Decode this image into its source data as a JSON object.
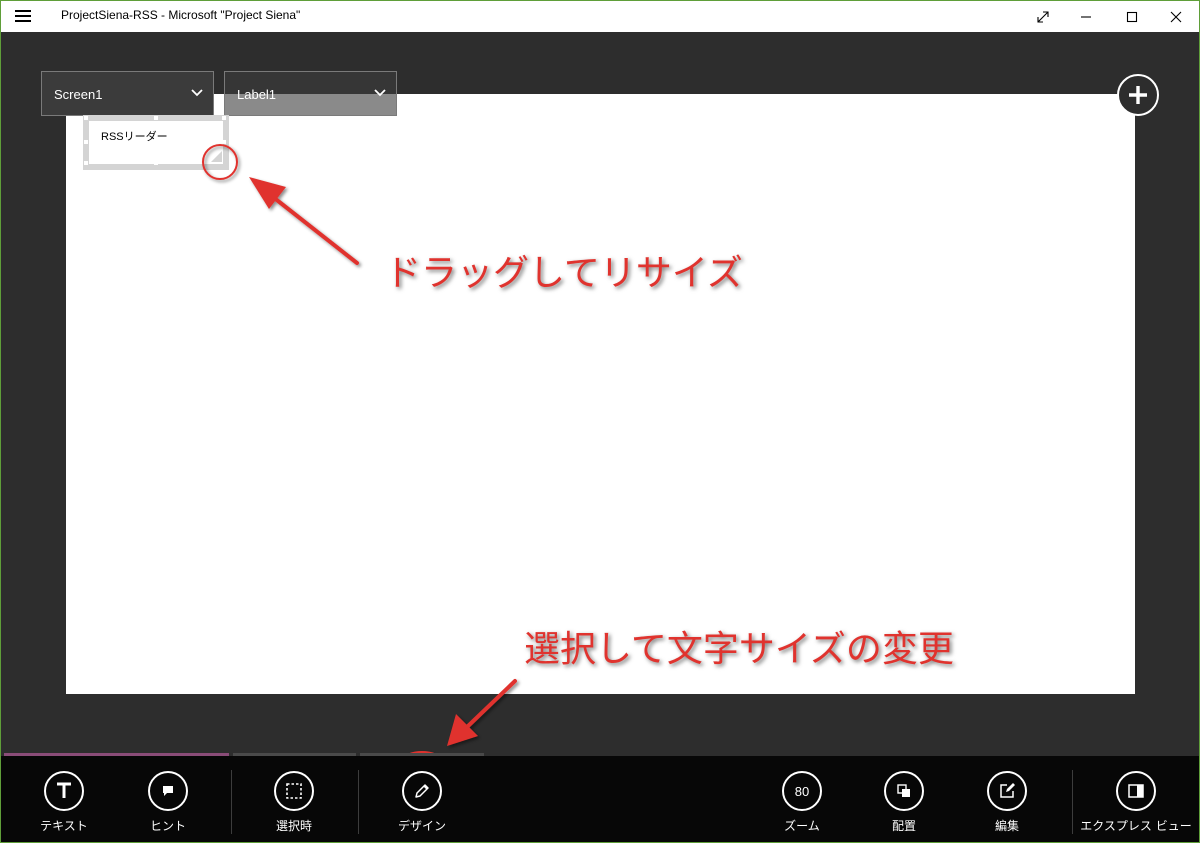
{
  "window": {
    "title": "ProjectSiena-RSS - Microsoft \"Project Siena\""
  },
  "selectors": {
    "screen": "Screen1",
    "control": "Label1"
  },
  "canvas": {
    "label_text": "RSSリーダー"
  },
  "annotations": {
    "resize_hint": "ドラッグしてリサイズ",
    "design_hint": "選択して文字サイズの変更"
  },
  "appbar": {
    "text_label": "テキスト",
    "hint_label": "ヒント",
    "onselect_label": "選択時",
    "design_label": "デザイン",
    "zoom_value": "80",
    "zoom_label": "ズーム",
    "arrange_label": "配置",
    "edit_label": "編集",
    "express_view_label": "エクスプレス ビュー"
  },
  "colors": {
    "window_border": "#5f9e39",
    "app_background": "#2d2d2d",
    "appbar_background": "#070707",
    "annotation_red": "#e0332e",
    "active_tab": "#8a4c78"
  }
}
